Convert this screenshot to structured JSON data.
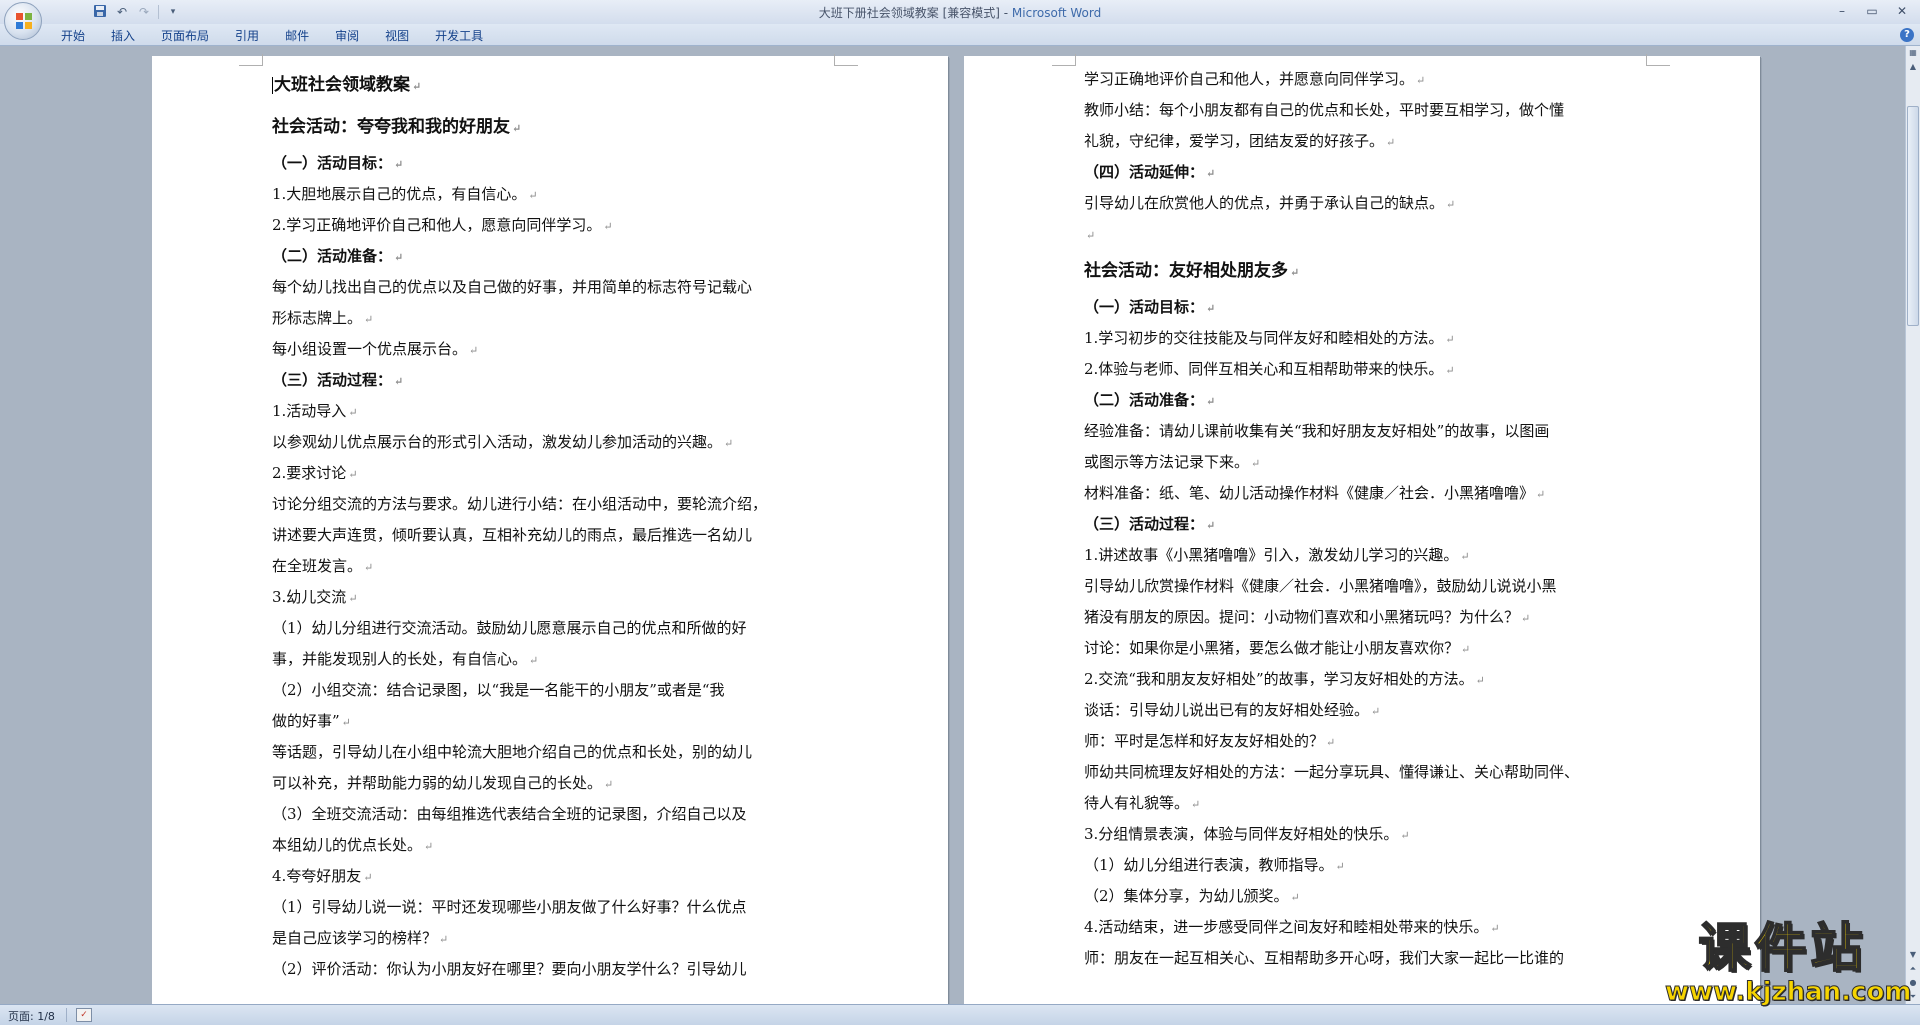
{
  "window": {
    "title": "大班下册社会领域教案 [兼容模式] - ",
    "app_name": "Microsoft Word",
    "controls": [
      "–",
      "▭",
      "✕"
    ]
  },
  "quick_access": {
    "save_icon": "save-icon",
    "undo_icon": "undo-icon",
    "redo_icon": "redo-icon",
    "customize_icon": "dropdown-icon"
  },
  "ribbon": {
    "tabs": [
      "开始",
      "插入",
      "页面布局",
      "引用",
      "邮件",
      "审阅",
      "视图",
      "开发工具"
    ],
    "help": "?"
  },
  "document": {
    "left_page": [
      {
        "text": "大班社会领域教案",
        "style": "h1"
      },
      {
        "text": "社会活动：夸夸我和我的好朋友",
        "style": "h2"
      },
      {
        "text": "（一）活动目标：",
        "style": "h3"
      },
      {
        "text": "1.大胆地展示自己的优点，有自信心。",
        "style": "p"
      },
      {
        "text": "2.学习正确地评价自己和他人，愿意向同伴学习。",
        "style": "p"
      },
      {
        "text": "（二）活动准备：",
        "style": "h3"
      },
      {
        "text": "每个幼儿找出自己的优点以及自己做的好事，并用简单的标志符号记载心",
        "style": "p",
        "nomark": true
      },
      {
        "text": "形标志牌上。",
        "style": "p"
      },
      {
        "text": "每小组设置一个优点展示台。",
        "style": "p"
      },
      {
        "text": "（三）活动过程：",
        "style": "h3"
      },
      {
        "text": "1.活动导入",
        "style": "p"
      },
      {
        "text": "以参观幼儿优点展示台的形式引入活动，激发幼儿参加活动的兴趣。",
        "style": "p"
      },
      {
        "text": "2.要求讨论",
        "style": "p"
      },
      {
        "text": "讨论分组交流的方法与要求。幼儿进行小结：在小组活动中，要轮流介绍，",
        "style": "p",
        "nomark": true
      },
      {
        "text": "讲述要大声连贯，倾听要认真，互相补充幼儿的雨点，最后推选一名幼儿",
        "style": "p",
        "nomark": true
      },
      {
        "text": "在全班发言。",
        "style": "p"
      },
      {
        "text": "3.幼儿交流",
        "style": "p"
      },
      {
        "text": "（1）幼儿分组进行交流活动。鼓励幼儿愿意展示自己的优点和所做的好",
        "style": "p",
        "nomark": true
      },
      {
        "text": "事，并能发现别人的长处，有自信心。",
        "style": "p"
      },
      {
        "text": "（2）小组交流：结合记录图，以“我是一名能干的小朋友”或者是“我",
        "style": "p",
        "nomark": true
      },
      {
        "text": "做的好事”",
        "style": "p"
      },
      {
        "text": "等话题，引导幼儿在小组中轮流大胆地介绍自己的优点和长处，别的幼儿",
        "style": "p",
        "nomark": true
      },
      {
        "text": "可以补充，并帮助能力弱的幼儿发现自己的长处。",
        "style": "p"
      },
      {
        "text": "（3）全班交流活动：由每组推选代表结合全班的记录图，介绍自己以及",
        "style": "p",
        "nomark": true
      },
      {
        "text": "本组幼儿的优点长处。",
        "style": "p"
      },
      {
        "text": "4.夸夸好朋友",
        "style": "p"
      },
      {
        "text": "（1）引导幼儿说一说：平时还发现哪些小朋友做了什么好事？什么优点",
        "style": "p",
        "nomark": true
      },
      {
        "text": "是自己应该学习的榜样？",
        "style": "p"
      },
      {
        "text": "（2）评价活动：你认为小朋友好在哪里？要向小朋友学什么？引导幼儿",
        "style": "p",
        "nomark": true
      }
    ],
    "right_page": [
      {
        "text": "学习正确地评价自己和他人，并愿意向同伴学习。",
        "style": "p"
      },
      {
        "text": "教师小结：每个小朋友都有自己的优点和长处，平时要互相学习，做个懂",
        "style": "p",
        "nomark": true
      },
      {
        "text": "礼貌，守纪律，爱学习，团结友爱的好孩子。",
        "style": "p"
      },
      {
        "text": "（四）活动延伸：",
        "style": "h3"
      },
      {
        "text": "引导幼儿在欣赏他人的优点，并勇于承认自己的缺点。",
        "style": "p"
      },
      {
        "text": "",
        "style": "p"
      },
      {
        "text": "社会活动：友好相处朋友多",
        "style": "h2"
      },
      {
        "text": "（一）活动目标：",
        "style": "h3"
      },
      {
        "text": "1.学习初步的交往技能及与同伴友好和睦相处的方法。",
        "style": "p"
      },
      {
        "text": "2.体验与老师、同伴互相关心和互相帮助带来的快乐。",
        "style": "p"
      },
      {
        "text": "（二）活动准备：",
        "style": "h3"
      },
      {
        "text": "经验准备：请幼儿课前收集有关“我和好朋友友好相处”的故事，以图画",
        "style": "p",
        "nomark": true
      },
      {
        "text": "或图示等方法记录下来。",
        "style": "p"
      },
      {
        "text": "材料准备：纸、笔、幼儿活动操作材料《健康／社会．小黑猪噜噜》",
        "style": "p"
      },
      {
        "text": "（三）活动过程：",
        "style": "h3"
      },
      {
        "text": "1.讲述故事《小黑猪噜噜》引入，激发幼儿学习的兴趣。",
        "style": "p"
      },
      {
        "text": "引导幼儿欣赏操作材料《健康／社会．小黑猪噜噜》，鼓励幼儿说说小黑",
        "style": "p",
        "nomark": true
      },
      {
        "text": "猪没有朋友的原因。提问：小动物们喜欢和小黑猪玩吗？为什么？",
        "style": "p"
      },
      {
        "text": "讨论：如果你是小黑猪，要怎么做才能让小朋友喜欢你？",
        "style": "p"
      },
      {
        "text": "2.交流“我和朋友友好相处”的故事，学习友好相处的方法。",
        "style": "p"
      },
      {
        "text": "谈话：引导幼儿说出已有的友好相处经验。",
        "style": "p"
      },
      {
        "text": "师：平时是怎样和好友友好相处的？",
        "style": "p"
      },
      {
        "text": "师幼共同梳理友好相处的方法：一起分享玩具、懂得谦让、关心帮助同伴、",
        "style": "p",
        "nomark": true
      },
      {
        "text": "待人有礼貌等。",
        "style": "p"
      },
      {
        "text": "3.分组情景表演，体验与同伴友好相处的快乐。",
        "style": "p"
      },
      {
        "text": "（1）幼儿分组进行表演，教师指导。",
        "style": "p"
      },
      {
        "text": "（2）集体分享，为幼儿颁奖。",
        "style": "p"
      },
      {
        "text": "4.活动结束，进一步感受同伴之间友好和睦相处带来的快乐。",
        "style": "p"
      },
      {
        "text": "师：朋友在一起互相关心、互相帮助多开心呀，我们大家一起比一比谁的",
        "style": "p",
        "nomark": true
      }
    ],
    "paragraph_mark": "↵"
  },
  "statusbar": {
    "page_count": "页面: 1/8",
    "proof_icon": "proofing-icon"
  },
  "watermark": {
    "title": "课件站",
    "url": "www.kjzhan.com"
  },
  "colors": {
    "accent": "#15428b",
    "background": "#a9b4c2",
    "watermark": "#f6d400"
  }
}
